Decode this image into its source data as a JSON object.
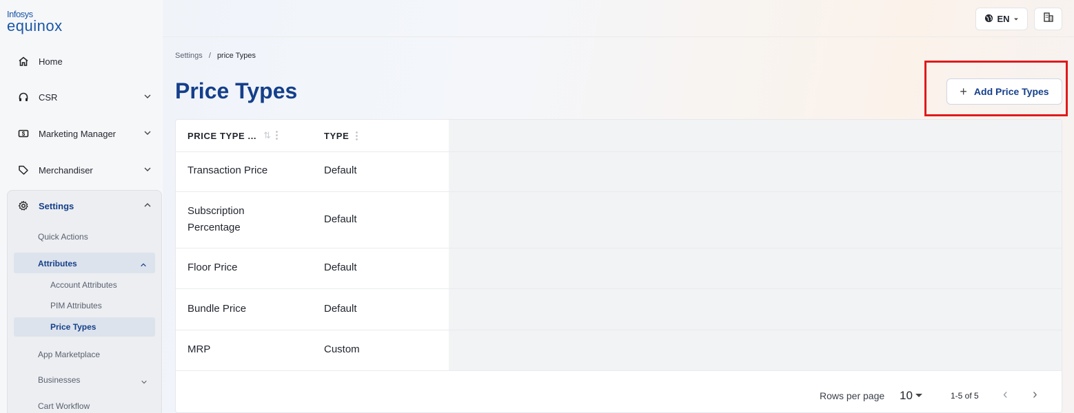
{
  "brand": {
    "top": "Infosys",
    "name": "equinox"
  },
  "sidebar": {
    "home": "Home",
    "csr": "CSR",
    "marketing": "Marketing Manager",
    "merchandiser": "Merchandiser",
    "settings": "Settings",
    "quick_actions": "Quick Actions",
    "attributes": "Attributes",
    "account_attributes": "Account Attributes",
    "pim_attributes": "PIM Attributes",
    "price_types": "Price Types",
    "app_marketplace": "App Marketplace",
    "businesses": "Businesses",
    "cart_workflow": "Cart Workflow"
  },
  "topbar": {
    "language": "EN"
  },
  "breadcrumb": {
    "root": "Settings",
    "sep": "/",
    "current": "price Types"
  },
  "page": {
    "title": "Price Types",
    "add_button": "Add Price Types"
  },
  "table": {
    "headers": {
      "name": "PRICE TYPE ...",
      "type": "TYPE"
    },
    "rows": [
      {
        "name": "Transaction Price",
        "type": "Default"
      },
      {
        "name": "Subscription Percentage",
        "type": "Default"
      },
      {
        "name": "Floor Price",
        "type": "Default"
      },
      {
        "name": "Bundle Price",
        "type": "Default"
      },
      {
        "name": "MRP",
        "type": "Custom"
      }
    ]
  },
  "pagination": {
    "rows_per_page_label": "Rows per page",
    "rows_per_page": "10",
    "range": "1-5 of 5"
  },
  "colors": {
    "accent": "#143f8a",
    "highlight": "#e0191c"
  }
}
